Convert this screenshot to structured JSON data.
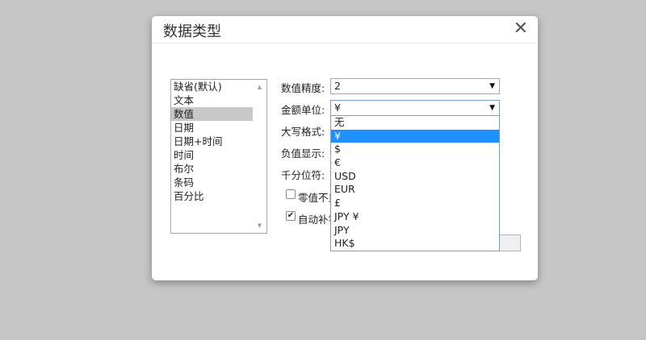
{
  "dialog": {
    "title": "数据类型",
    "close_glyph": "✕"
  },
  "type_list": {
    "items": [
      "缺省(默认)",
      "文本",
      "数值",
      "日期",
      "日期+时间",
      "时间",
      "布尔",
      "条码",
      "百分比"
    ],
    "selected": "数值",
    "scroll_up_glyph": "▲",
    "scroll_down_glyph": "▼"
  },
  "form": {
    "precision_label": "数值精度:",
    "precision_value": "2",
    "currency_label": "金额单位:",
    "currency_value": "¥",
    "uppercase_label": "大写格式:",
    "negative_label": "负值显示:",
    "thousands_label": "千分位符:",
    "zero_checkbox_label": "零值不显",
    "zero_checked": false,
    "autofill_checkbox_label": "自动补零",
    "autofill_checked": true,
    "select_arrow_glyph": "▼",
    "check_glyph": "✔"
  },
  "currency_dropdown": {
    "options": [
      "无",
      "¥",
      "$",
      "€",
      "USD",
      "EUR",
      "£",
      "JPY ¥",
      "JPY",
      "HK$"
    ],
    "highlighted": "¥"
  },
  "colors": {
    "highlight": "#1e90ff",
    "list_selection": "#c8c8c8",
    "backdrop": "#c6c6c6"
  }
}
